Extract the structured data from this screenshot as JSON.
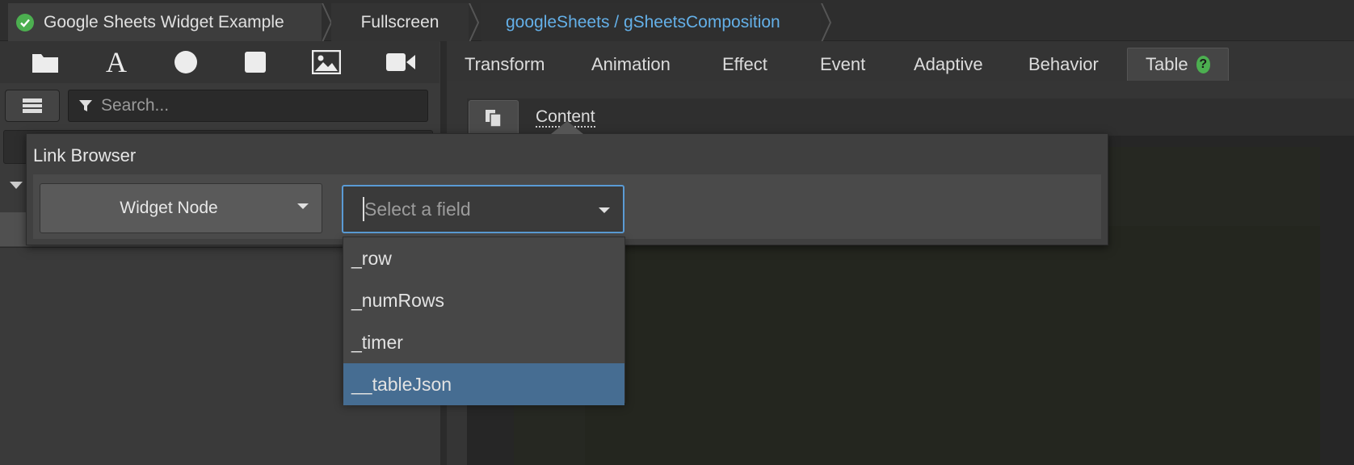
{
  "breadcrumb": {
    "items": [
      {
        "label": "Google Sheets Widget Example",
        "status_icon": "check-circle-icon"
      },
      {
        "label": "Fullscreen"
      },
      {
        "label": "googleSheets / gSheetsComposition"
      }
    ]
  },
  "toolbar": {
    "icons": [
      "folder-icon",
      "text-icon",
      "circle-icon",
      "square-icon",
      "image-icon",
      "video-icon"
    ],
    "text_icon_glyph": "A"
  },
  "left_panel": {
    "search": {
      "placeholder": "Search..."
    }
  },
  "tabs": [
    {
      "label": "Transform"
    },
    {
      "label": "Animation"
    },
    {
      "label": "Effect"
    },
    {
      "label": "Event"
    },
    {
      "label": "Adaptive"
    },
    {
      "label": "Behavior"
    },
    {
      "label": "Table",
      "active": true,
      "help_glyph": "?"
    }
  ],
  "content": {
    "label": "Content"
  },
  "link_browser": {
    "title": "Link Browser",
    "node_button": "Widget Node",
    "field_select": {
      "placeholder": "Select a field",
      "value": ""
    },
    "options": [
      "_row",
      "_numRows",
      "_timer",
      "__tableJson"
    ],
    "highlighted_option": "__tableJson"
  },
  "colors": {
    "accent_blue": "#64b0e8",
    "select_border": "#5a9bd5",
    "highlight": "#466d92",
    "success_green": "#4caf50"
  }
}
